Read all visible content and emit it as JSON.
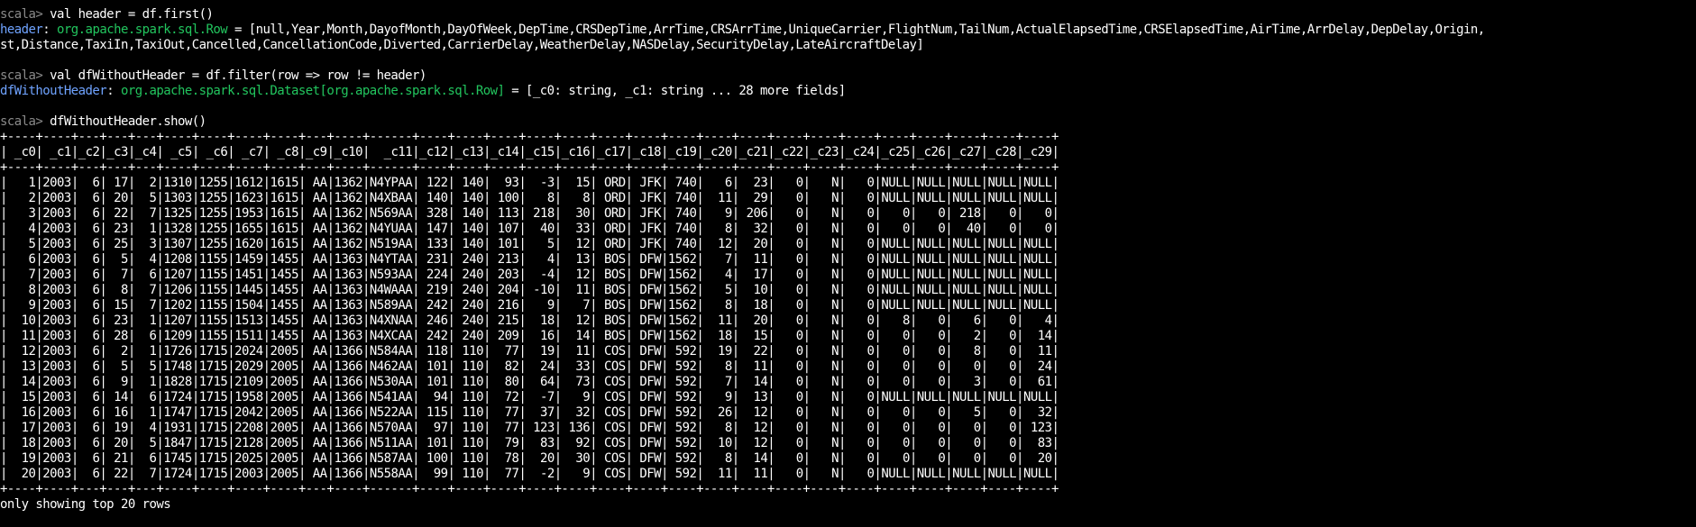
{
  "session": {
    "cmd1": {
      "prompt": "scala> ",
      "command": "val header = df.first()",
      "var_name": "header",
      "type_name": "org.apache.spark.sql.Row",
      "value_line1": " = [null,Year,Month,DayofMonth,DayOfWeek,DepTime,CRSDepTime,ArrTime,CRSArrTime,UniqueCarrier,FlightNum,TailNum,ActualElapsedTime,CRSElapsedTime,AirTime,ArrDelay,DepDelay,Origin,",
      "value_line2": "st,Distance,TaxiIn,TaxiOut,Cancelled,CancellationCode,Diverted,CarrierDelay,WeatherDelay,NASDelay,SecurityDelay,LateAircraftDelay]"
    },
    "cmd2": {
      "prompt": "scala> ",
      "command": "val dfWithoutHeader = df.filter(row => row != header)",
      "var_name": "dfWithoutHeader",
      "type_name": "org.apache.spark.sql.Dataset[org.apache.spark.sql.Row]",
      "value": " = [_c0: string, _c1: string ... 28 more fields]"
    },
    "cmd3": {
      "prompt": "scala> ",
      "command": "dfWithoutHeader.show()"
    },
    "footer": "only showing top 20 rows"
  },
  "table": {
    "widths": [
      4,
      4,
      3,
      3,
      3,
      4,
      4,
      4,
      4,
      3,
      4,
      6,
      4,
      4,
      4,
      4,
      4,
      4,
      4,
      4,
      4,
      4,
      4,
      4,
      4,
      4,
      4,
      4,
      4,
      4
    ],
    "headers": [
      "_c0",
      "_c1",
      "_c2",
      "_c3",
      "_c4",
      "_c5",
      "_c6",
      "_c7",
      "_c8",
      "_c9",
      "_c10",
      "_c11",
      "_c12",
      "_c13",
      "_c14",
      "_c15",
      "_c16",
      "_c17",
      "_c18",
      "_c19",
      "_c20",
      "_c21",
      "_c22",
      "_c23",
      "_c24",
      "_c25",
      "_c26",
      "_c27",
      "_c28",
      "_c29"
    ],
    "rows": [
      [
        "1",
        "2003",
        "6",
        "17",
        "2",
        "1310",
        "1255",
        "1612",
        "1615",
        "AA",
        "1362",
        "N4YPAA",
        "122",
        "140",
        "93",
        "-3",
        "15",
        "ORD",
        "JFK",
        "740",
        "6",
        "23",
        "0",
        "N",
        "0",
        "NULL",
        "NULL",
        "NULL",
        "NULL",
        "NULL"
      ],
      [
        "2",
        "2003",
        "6",
        "20",
        "5",
        "1303",
        "1255",
        "1623",
        "1615",
        "AA",
        "1362",
        "N4XBAA",
        "140",
        "140",
        "100",
        "8",
        "8",
        "ORD",
        "JFK",
        "740",
        "11",
        "29",
        "0",
        "N",
        "0",
        "NULL",
        "NULL",
        "NULL",
        "NULL",
        "NULL"
      ],
      [
        "3",
        "2003",
        "6",
        "22",
        "7",
        "1325",
        "1255",
        "1953",
        "1615",
        "AA",
        "1362",
        "N569AA",
        "328",
        "140",
        "113",
        "218",
        "30",
        "ORD",
        "JFK",
        "740",
        "9",
        "206",
        "0",
        "N",
        "0",
        "0",
        "0",
        "218",
        "0",
        "0"
      ],
      [
        "4",
        "2003",
        "6",
        "23",
        "1",
        "1328",
        "1255",
        "1655",
        "1615",
        "AA",
        "1362",
        "N4YUAA",
        "147",
        "140",
        "107",
        "40",
        "33",
        "ORD",
        "JFK",
        "740",
        "8",
        "32",
        "0",
        "N",
        "0",
        "0",
        "0",
        "40",
        "0",
        "0"
      ],
      [
        "5",
        "2003",
        "6",
        "25",
        "3",
        "1307",
        "1255",
        "1620",
        "1615",
        "AA",
        "1362",
        "N519AA",
        "133",
        "140",
        "101",
        "5",
        "12",
        "ORD",
        "JFK",
        "740",
        "12",
        "20",
        "0",
        "N",
        "0",
        "NULL",
        "NULL",
        "NULL",
        "NULL",
        "NULL"
      ],
      [
        "6",
        "2003",
        "6",
        "5",
        "4",
        "1208",
        "1155",
        "1459",
        "1455",
        "AA",
        "1363",
        "N4YTAA",
        "231",
        "240",
        "213",
        "4",
        "13",
        "BOS",
        "DFW",
        "1562",
        "7",
        "11",
        "0",
        "N",
        "0",
        "NULL",
        "NULL",
        "NULL",
        "NULL",
        "NULL"
      ],
      [
        "7",
        "2003",
        "6",
        "7",
        "6",
        "1207",
        "1155",
        "1451",
        "1455",
        "AA",
        "1363",
        "N593AA",
        "224",
        "240",
        "203",
        "-4",
        "12",
        "BOS",
        "DFW",
        "1562",
        "4",
        "17",
        "0",
        "N",
        "0",
        "NULL",
        "NULL",
        "NULL",
        "NULL",
        "NULL"
      ],
      [
        "8",
        "2003",
        "6",
        "8",
        "7",
        "1206",
        "1155",
        "1445",
        "1455",
        "AA",
        "1363",
        "N4WAAA",
        "219",
        "240",
        "204",
        "-10",
        "11",
        "BOS",
        "DFW",
        "1562",
        "5",
        "10",
        "0",
        "N",
        "0",
        "NULL",
        "NULL",
        "NULL",
        "NULL",
        "NULL"
      ],
      [
        "9",
        "2003",
        "6",
        "15",
        "7",
        "1202",
        "1155",
        "1504",
        "1455",
        "AA",
        "1363",
        "N589AA",
        "242",
        "240",
        "216",
        "9",
        "7",
        "BOS",
        "DFW",
        "1562",
        "8",
        "18",
        "0",
        "N",
        "0",
        "NULL",
        "NULL",
        "NULL",
        "NULL",
        "NULL"
      ],
      [
        "10",
        "2003",
        "6",
        "23",
        "1",
        "1207",
        "1155",
        "1513",
        "1455",
        "AA",
        "1363",
        "N4XNAA",
        "246",
        "240",
        "215",
        "18",
        "12",
        "BOS",
        "DFW",
        "1562",
        "11",
        "20",
        "0",
        "N",
        "0",
        "8",
        "0",
        "6",
        "0",
        "4"
      ],
      [
        "11",
        "2003",
        "6",
        "28",
        "6",
        "1209",
        "1155",
        "1511",
        "1455",
        "AA",
        "1363",
        "N4XCAA",
        "242",
        "240",
        "209",
        "16",
        "14",
        "BOS",
        "DFW",
        "1562",
        "18",
        "15",
        "0",
        "N",
        "0",
        "0",
        "0",
        "2",
        "0",
        "14"
      ],
      [
        "12",
        "2003",
        "6",
        "2",
        "1",
        "1726",
        "1715",
        "2024",
        "2005",
        "AA",
        "1366",
        "N584AA",
        "118",
        "110",
        "77",
        "19",
        "11",
        "COS",
        "DFW",
        "592",
        "19",
        "22",
        "0",
        "N",
        "0",
        "0",
        "0",
        "8",
        "0",
        "11"
      ],
      [
        "13",
        "2003",
        "6",
        "5",
        "5",
        "1748",
        "1715",
        "2029",
        "2005",
        "AA",
        "1366",
        "N462AA",
        "101",
        "110",
        "82",
        "24",
        "33",
        "COS",
        "DFW",
        "592",
        "8",
        "11",
        "0",
        "N",
        "0",
        "0",
        "0",
        "0",
        "0",
        "24"
      ],
      [
        "14",
        "2003",
        "6",
        "9",
        "1",
        "1828",
        "1715",
        "2109",
        "2005",
        "AA",
        "1366",
        "N530AA",
        "101",
        "110",
        "80",
        "64",
        "73",
        "COS",
        "DFW",
        "592",
        "7",
        "14",
        "0",
        "N",
        "0",
        "0",
        "0",
        "3",
        "0",
        "61"
      ],
      [
        "15",
        "2003",
        "6",
        "14",
        "6",
        "1724",
        "1715",
        "1958",
        "2005",
        "AA",
        "1366",
        "N541AA",
        "94",
        "110",
        "72",
        "-7",
        "9",
        "COS",
        "DFW",
        "592",
        "9",
        "13",
        "0",
        "N",
        "0",
        "NULL",
        "NULL",
        "NULL",
        "NULL",
        "NULL"
      ],
      [
        "16",
        "2003",
        "6",
        "16",
        "1",
        "1747",
        "1715",
        "2042",
        "2005",
        "AA",
        "1366",
        "N522AA",
        "115",
        "110",
        "77",
        "37",
        "32",
        "COS",
        "DFW",
        "592",
        "26",
        "12",
        "0",
        "N",
        "0",
        "0",
        "0",
        "5",
        "0",
        "32"
      ],
      [
        "17",
        "2003",
        "6",
        "19",
        "4",
        "1931",
        "1715",
        "2208",
        "2005",
        "AA",
        "1366",
        "N570AA",
        "97",
        "110",
        "77",
        "123",
        "136",
        "COS",
        "DFW",
        "592",
        "8",
        "12",
        "0",
        "N",
        "0",
        "0",
        "0",
        "0",
        "0",
        "123"
      ],
      [
        "18",
        "2003",
        "6",
        "20",
        "5",
        "1847",
        "1715",
        "2128",
        "2005",
        "AA",
        "1366",
        "N511AA",
        "101",
        "110",
        "79",
        "83",
        "92",
        "COS",
        "DFW",
        "592",
        "10",
        "12",
        "0",
        "N",
        "0",
        "0",
        "0",
        "0",
        "0",
        "83"
      ],
      [
        "19",
        "2003",
        "6",
        "21",
        "6",
        "1745",
        "1715",
        "2025",
        "2005",
        "AA",
        "1366",
        "N587AA",
        "100",
        "110",
        "78",
        "20",
        "30",
        "COS",
        "DFW",
        "592",
        "8",
        "14",
        "0",
        "N",
        "0",
        "0",
        "0",
        "0",
        "0",
        "20"
      ],
      [
        "20",
        "2003",
        "6",
        "22",
        "7",
        "1724",
        "1715",
        "2003",
        "2005",
        "AA",
        "1366",
        "N558AA",
        "99",
        "110",
        "77",
        "-2",
        "9",
        "COS",
        "DFW",
        "592",
        "11",
        "11",
        "0",
        "N",
        "0",
        "NULL",
        "NULL",
        "NULL",
        "NULL",
        "NULL"
      ]
    ]
  }
}
